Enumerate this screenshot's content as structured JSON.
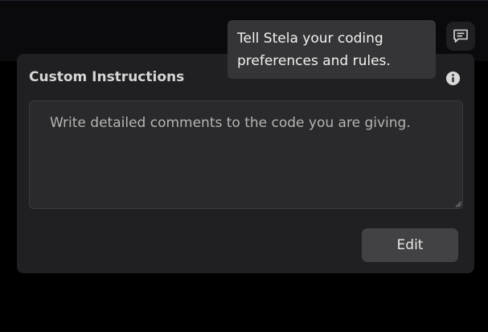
{
  "tooltip": {
    "text": "Tell Stela your coding preferences and rules."
  },
  "panel": {
    "title": "Custom Instructions",
    "instructions_value": "Write detailed comments to the code you are giving.",
    "edit_label": "Edit"
  },
  "icons": {
    "chat": "chat-bubble-icon",
    "info": "info-icon",
    "resize": "resize-grip-icon"
  },
  "colors": {
    "page_bg": "#000000",
    "panel_bg": "#202022",
    "tooltip_bg": "#353537",
    "button_bg": "#424244"
  }
}
